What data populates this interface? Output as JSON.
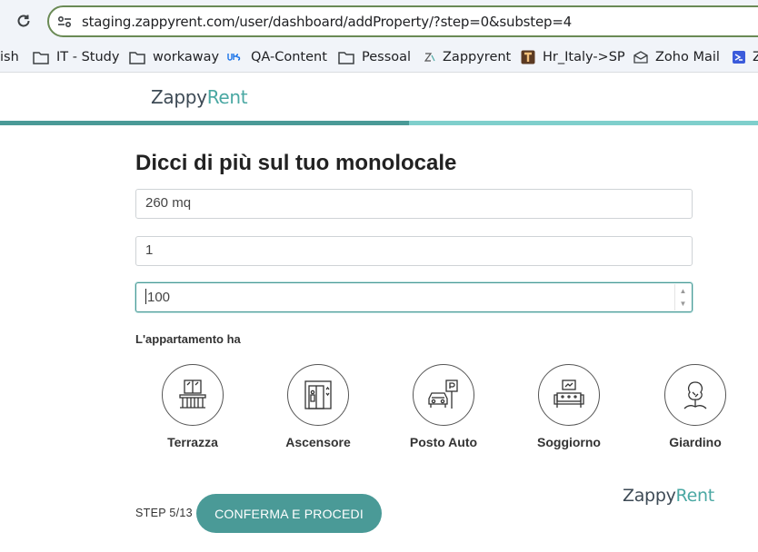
{
  "browser": {
    "url": "staging.zappyrent.com/user/dashboard/addProperty/?step=0&substep=4",
    "bookmarks": [
      {
        "label": "ish",
        "icon": "none"
      },
      {
        "label": "IT - Study",
        "icon": "folder-icon"
      },
      {
        "label": "workaway",
        "icon": "folder-icon"
      },
      {
        "label": "QA-Content",
        "icon": "ubs-icon"
      },
      {
        "label": "Pessoal",
        "icon": "folder-icon"
      },
      {
        "label": "Zappyrent",
        "icon": "zappyrent-icon"
      },
      {
        "label": "Hr_Italy->SP",
        "icon": "t-icon"
      },
      {
        "label": "Zoho Mail",
        "icon": "mail-icon"
      },
      {
        "label": "Z",
        "icon": "z-blue-icon"
      }
    ]
  },
  "header": {
    "logo_prefix": "Zappy",
    "logo_suffix": "Rent",
    "progress_fraction": 0.54
  },
  "form": {
    "title": "Dicci di più sul tuo monolocale",
    "fields": [
      {
        "value": "260 mq"
      },
      {
        "value": "1"
      },
      {
        "value": "100"
      }
    ],
    "amenities_label": "L'appartamento ha",
    "amenities": [
      {
        "label": "Terrazza",
        "icon": "balcony-icon"
      },
      {
        "label": "Ascensore",
        "icon": "elevator-icon"
      },
      {
        "label": "Posto Auto",
        "icon": "parking-icon"
      },
      {
        "label": "Soggiorno",
        "icon": "living-room-icon"
      },
      {
        "label": "Giardino",
        "icon": "garden-icon"
      }
    ]
  },
  "footer": {
    "step": "STEP 5/13",
    "confirm_label": "CONFERMA E PROCEDI",
    "logo_prefix": "Zappy",
    "logo_suffix": "Rent"
  },
  "colors": {
    "accent": "#4a9a97",
    "progress_track": "#7fcfcc"
  }
}
